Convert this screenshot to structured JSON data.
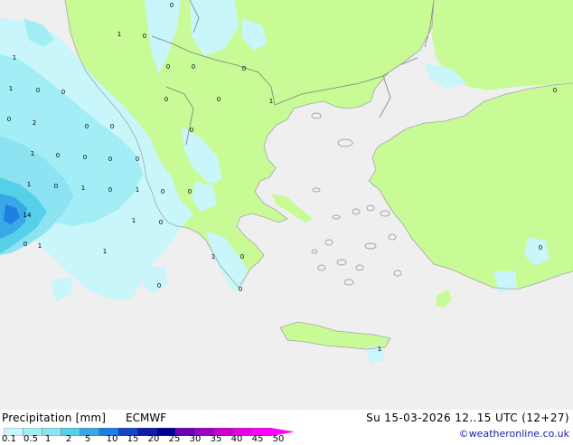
{
  "map": {
    "colors": {
      "sea": "#efefef",
      "land_dry": "#c8fa96",
      "coast": "#a6a6a6",
      "border": "#7f7f7f",
      "precip_0_1": "#c8f6fa",
      "precip_0_5": "#a3eef6",
      "precip_1": "#8ee3f2",
      "precip_2": "#56cfe9",
      "precip_5": "#3aa7e6",
      "precip_10": "#1e7ee2"
    },
    "cell_values": [
      "0",
      "1",
      "0",
      "1",
      "0",
      "0",
      "0",
      "1",
      "0",
      "0",
      "0",
      "0",
      "1",
      "0",
      "0",
      "2",
      "0",
      "0",
      "0",
      "0",
      "1",
      "0",
      "0",
      "0",
      "1",
      "0",
      "1",
      "0",
      "1",
      "0",
      "0",
      "1",
      "0",
      "1",
      "1",
      "0",
      "0",
      "0",
      "1",
      "0",
      "0",
      "14",
      "1"
    ]
  },
  "legend": {
    "title": "Precipitation [mm]",
    "model": "ECMWF",
    "ticks": [
      "0.1",
      "0.5",
      "1",
      "2",
      "5",
      "10",
      "15",
      "20",
      "25",
      "30",
      "35",
      "40",
      "45",
      "50"
    ],
    "colors": [
      "#c8f6fa",
      "#a3eef6",
      "#8ee3f2",
      "#56cfe9",
      "#3aa7e6",
      "#1e7ee2",
      "#1446c8",
      "#0a1fa8",
      "#000096",
      "#6a00b4",
      "#9b00c8",
      "#c800c8",
      "#e600e6",
      "#ff00ff"
    ]
  },
  "valid_time": "Su 15-03-2026 12..15 UTC (12+27)",
  "credit": "©weatheronline.co.uk"
}
